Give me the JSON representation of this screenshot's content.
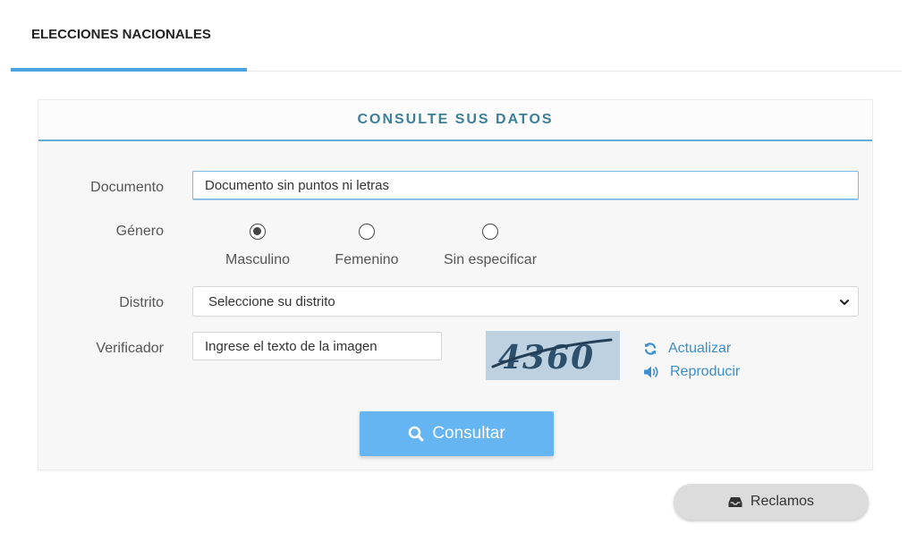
{
  "tabs": [
    {
      "label": "ELECCIONES NACIONALES",
      "active": true
    }
  ],
  "panel": {
    "title": "CONSULTE SUS DATOS",
    "documento": {
      "label": "Documento",
      "placeholder": "Documento sin puntos ni letras"
    },
    "genero": {
      "label": "Género",
      "options": [
        {
          "label": "Masculino",
          "checked": true
        },
        {
          "label": "Femenino",
          "checked": false
        },
        {
          "label": "Sin especificar",
          "checked": false
        }
      ]
    },
    "distrito": {
      "label": "Distrito",
      "selected": "Seleccione su distrito"
    },
    "verificador": {
      "label": "Verificador",
      "placeholder": "Ingrese el texto de la imagen",
      "captcha_text": "4360",
      "refresh_label": "Actualizar",
      "audio_label": "Reproducir"
    },
    "submit_label": "Consultar"
  },
  "reclamos_label": "Reclamos",
  "colors": {
    "accent": "#4aa3df",
    "link": "#3b8fd1",
    "button": "#64b5f2",
    "title": "#3d7f99"
  },
  "icons": [
    "search-icon",
    "refresh-icon",
    "speaker-icon",
    "inbox-icon",
    "chevron-down-icon"
  ]
}
